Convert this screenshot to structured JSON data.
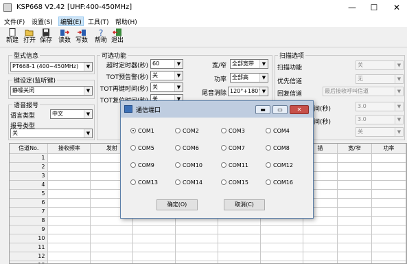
{
  "window": {
    "title": "KSP668 V2.42",
    "freq_range": "[UHF:400-450MHz]",
    "minimize": "—",
    "maximize": "☐",
    "close": "✕"
  },
  "menu": [
    "文件(F)",
    "设置(S)",
    "编辑(E)",
    "工具(T)",
    "帮助(H)"
  ],
  "toolbar": [
    "新建",
    "打开",
    "保存",
    "读数",
    "写数",
    "帮助",
    "退出"
  ],
  "model_group": {
    "legend": "型式信息",
    "value": "PT668-1 (400~450MHz)"
  },
  "key_group": {
    "legend": "键设定(监听键)",
    "value": "静噪关闭"
  },
  "voice_group": {
    "legend": "语音报号",
    "lang_label": "语言类型",
    "lang_value": "中文",
    "report_label": "报号类型",
    "report_value": "关"
  },
  "optional": {
    "legend": "可选功能",
    "rows": [
      {
        "label": "超时定时器(秒)",
        "value": "60"
      },
      {
        "label": "TOT预告警(秒)",
        "value": "关"
      },
      {
        "label": "TOT再键时间(秒)",
        "value": "关"
      },
      {
        "label": "TOT复位时间(秒)",
        "value": "关"
      }
    ],
    "right_rows": [
      {
        "label": "宽/窄",
        "value": "全部宽带"
      },
      {
        "label": "功率",
        "value": "全部高"
      },
      {
        "label": "尾音消除",
        "value": "120°+180°"
      }
    ]
  },
  "scan": {
    "legend": "扫描选项",
    "rows": [
      {
        "label": "扫描功能",
        "value": "关"
      },
      {
        "label": "优先信道",
        "value": "无"
      },
      {
        "label": "回复信道",
        "value": "最后接收呼叫信道"
      },
      {
        "label": "间(秒)",
        "value": "3.0"
      },
      {
        "label": "间(秒)",
        "value": "3.0"
      },
      {
        "label": "",
        "value": "关"
      }
    ]
  },
  "table": {
    "headers": [
      "信道No.",
      "接收频率",
      "发射",
      "",
      "",
      "",
      "",
      "描",
      "宽/窄",
      "功率"
    ],
    "rows": [
      "1",
      "2",
      "3",
      "4",
      "5",
      "6",
      "7",
      "8",
      "9",
      "10",
      "11",
      "12",
      "13"
    ]
  },
  "dialog": {
    "title": "通信端口",
    "ports": [
      "COM1",
      "COM2",
      "COM3",
      "COM4",
      "COM5",
      "COM6",
      "COM7",
      "COM8",
      "COM9",
      "COM10",
      "COM11",
      "COM12",
      "COM13",
      "COM14",
      "COM15",
      "COM16"
    ],
    "selected": "COM1",
    "ok": "确定(O)",
    "cancel": "取消(C)",
    "btn_min": "▬",
    "btn_max": "▭",
    "btn_close": "✕"
  }
}
